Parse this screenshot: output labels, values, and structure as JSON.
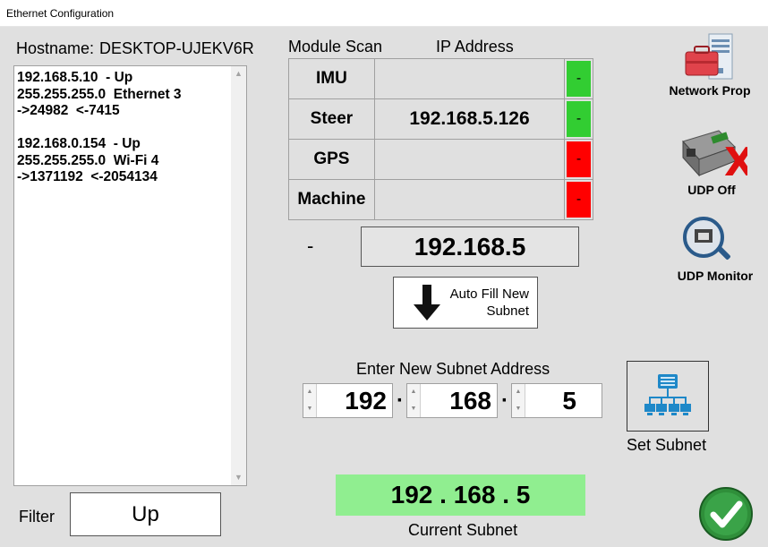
{
  "window": {
    "title": "Ethernet Configuration"
  },
  "hostname": {
    "label": "Hostname:",
    "value": "DESKTOP-UJEKV6R"
  },
  "adapters": {
    "text": "192.168.5.10  - Up\n255.255.255.0  Ethernet 3\n->24982  <-7415\n\n192.168.0.154  - Up\n255.255.255.0  Wi-Fi 4\n->1371192  <-2054134"
  },
  "filter": {
    "label": "Filter",
    "value": "Up"
  },
  "module_scan": {
    "col_module": "Module Scan",
    "col_ip": "IP Address",
    "rows": [
      {
        "name": "IMU",
        "ip": "",
        "status": "-",
        "color": "#32cd32"
      },
      {
        "name": "Steer",
        "ip": "192.168.5.126",
        "status": "-",
        "color": "#32cd32"
      },
      {
        "name": "GPS",
        "ip": "",
        "status": "-",
        "color": "#ff0000"
      },
      {
        "name": "Machine",
        "ip": "",
        "status": "-",
        "color": "#ff0000"
      }
    ]
  },
  "detected": {
    "dash": "-",
    "subnet": "192.168.5"
  },
  "autofill": {
    "line1": "Auto Fill New",
    "line2": "Subnet"
  },
  "new_subnet": {
    "label": "Enter New Subnet Address",
    "octet1": "192",
    "octet2": "168",
    "octet3": "5",
    "separator": "·"
  },
  "set_subnet": {
    "label": "Set Subnet"
  },
  "current_subnet": {
    "value": "192 . 168 . 5",
    "label": "Current Subnet",
    "color": "#90ee90"
  },
  "side_buttons": {
    "network_prop": "Network Prop",
    "udp_off": "UDP Off",
    "udp_monitor": "UDP Monitor"
  },
  "icons": {
    "network_prop": "network-properties-icon",
    "udp_off": "udp-off-icon",
    "udp_monitor": "udp-monitor-icon",
    "autofill": "down-arrow-icon",
    "set_subnet": "network-tree-icon",
    "ok": "green-check-icon"
  }
}
